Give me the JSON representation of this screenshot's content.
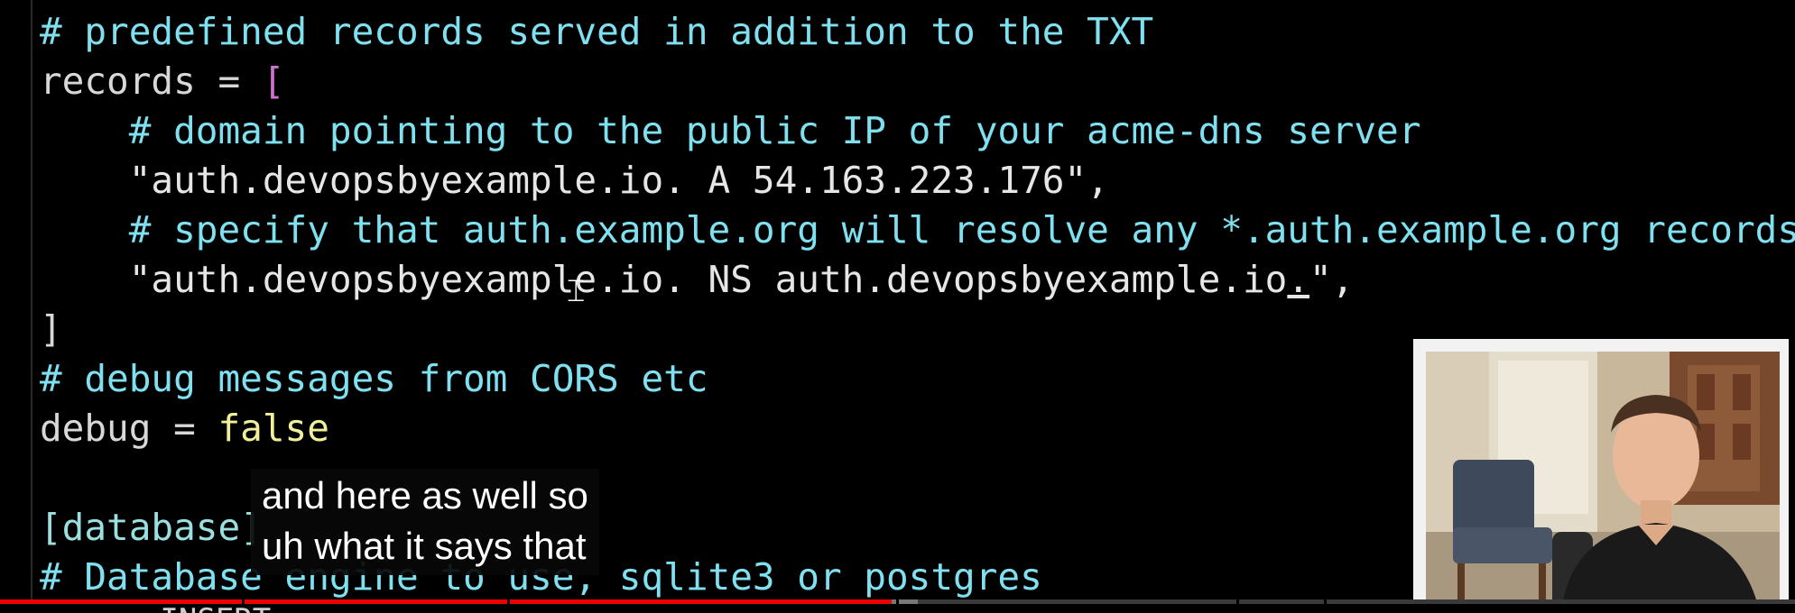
{
  "editor": {
    "lines": [
      {
        "segments": [
          {
            "cls": "comment",
            "text": "# predefined records served in addition to the TXT"
          }
        ]
      },
      {
        "segments": [
          {
            "cls": "",
            "text": "records = "
          },
          {
            "cls": "bracket",
            "text": "["
          }
        ]
      },
      {
        "segments": [
          {
            "cls": "comment",
            "text": "    # domain pointing to the public IP of your acme-dns server"
          }
        ]
      },
      {
        "segments": [
          {
            "cls": "str",
            "text": "    \"auth.devopsbyexample.io. A 54.163.223.176\","
          }
        ]
      },
      {
        "segments": [
          {
            "cls": "comment",
            "text": "    # specify that auth.example.org will resolve any *.auth.example.org records"
          }
        ]
      },
      {
        "segments": [
          {
            "cls": "str",
            "text": "    \"auth.devopsbyexample.io. NS auth.devopsbyexample.io"
          },
          {
            "cls": "str underline",
            "text": "."
          },
          {
            "cls": "str",
            "text": "\","
          }
        ]
      },
      {
        "segments": [
          {
            "cls": "bracket-close",
            "text": "]"
          }
        ]
      },
      {
        "segments": [
          {
            "cls": "comment",
            "text": "# debug messages from CORS etc"
          }
        ]
      },
      {
        "segments": [
          {
            "cls": "",
            "text": "debug = "
          },
          {
            "cls": "kw",
            "text": "false"
          }
        ]
      },
      {
        "segments": [
          {
            "cls": "",
            "text": ""
          }
        ]
      },
      {
        "segments": [
          {
            "cls": "section",
            "text": "[database]"
          }
        ]
      },
      {
        "segments": [
          {
            "cls": "comment",
            "text": "# Database engine to use, sqlite3 or postgres"
          }
        ]
      }
    ],
    "bottom_text": "-- INSERT --"
  },
  "captions": {
    "line1": "and here as well so",
    "line2": "uh what it says that"
  },
  "player": {
    "progress_fraction": 0.5,
    "buffer_end_fraction": 0.515
  },
  "icons": {
    "text-cursor": "I-beam"
  }
}
